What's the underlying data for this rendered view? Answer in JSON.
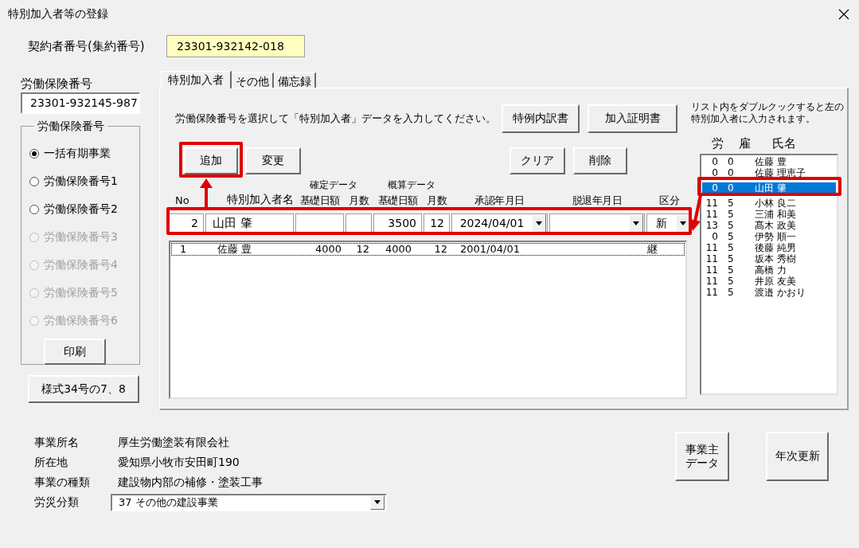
{
  "window": {
    "title": "特別加入者等の登録"
  },
  "contract": {
    "label": "契約者番号(集約番号)",
    "value": "23301-932142-018"
  },
  "insurance": {
    "label": "労働保険番号",
    "value": "23301-932145-987"
  },
  "group": {
    "title": "労働保険番号",
    "radios": [
      {
        "label": "一括有期事業",
        "selected": true,
        "disabled": false
      },
      {
        "label": "労働保険番号1",
        "selected": false,
        "disabled": false
      },
      {
        "label": "労働保険番号2",
        "selected": false,
        "disabled": false
      },
      {
        "label": "労働保険番号3",
        "selected": false,
        "disabled": true
      },
      {
        "label": "労働保険番号4",
        "selected": false,
        "disabled": true
      },
      {
        "label": "労働保険番号5",
        "selected": false,
        "disabled": true
      },
      {
        "label": "労働保険番号6",
        "selected": false,
        "disabled": true
      }
    ],
    "print_button": "印刷"
  },
  "form_button": "様式34号の7、8",
  "tabs": [
    {
      "label": "特別加入者",
      "selected": true
    },
    {
      "label": "その他",
      "selected": false
    },
    {
      "label": "備忘録",
      "selected": false
    }
  ],
  "panel": {
    "instruction": "労働保険番号を選択して「特別加入者」データを入力してください。",
    "doc_buttons": [
      "特例内訳書",
      "加入証明書"
    ],
    "edit_buttons": [
      "追加",
      "変更"
    ],
    "clear_buttons": [
      "クリア",
      "削除"
    ],
    "column_groups": [
      "確定データ",
      "概算データ"
    ],
    "columns": [
      "No",
      "特別加入者名",
      "基礎日額",
      "月数",
      "基礎日額",
      "月数",
      "承認年月日",
      "脱退年月日",
      "区分"
    ],
    "entry": [
      {
        "value": "2",
        "kind": "num"
      },
      {
        "value": "山田 肇",
        "kind": "text"
      },
      {
        "kind": "num"
      },
      {
        "kind": "num"
      },
      {
        "value": "3500",
        "kind": "num"
      },
      {
        "value": "12",
        "kind": "num"
      },
      {
        "value": "2024/04/01",
        "kind": "combo"
      },
      {
        "kind": "combo"
      },
      {
        "value": "新",
        "kind": "combo"
      }
    ],
    "rows": [
      [
        "1",
        "佐藤 豊",
        "4000",
        "12",
        "4000",
        "12",
        "2001/04/01",
        "",
        "継"
      ]
    ]
  },
  "side": {
    "hint": "リスト内をダブルクックすると左の特別加入者に入力されます。",
    "headers": [
      "労",
      "雇",
      "氏名"
    ],
    "rows": [
      {
        "cells": [
          "0",
          "0",
          "佐藤 豊"
        ],
        "selected": false
      },
      {
        "cells": [
          "0",
          "0",
          "佐藤 理恵子"
        ],
        "selected": false
      },
      {
        "cells": [
          "0",
          "0",
          "山田 肇"
        ],
        "selected": true
      },
      {
        "cells": [
          "11",
          "5",
          "小林 良二"
        ],
        "selected": false
      },
      {
        "cells": [
          "11",
          "5",
          "三浦 和美"
        ],
        "selected": false
      },
      {
        "cells": [
          "13",
          "5",
          "髙木 政美"
        ],
        "selected": false
      },
      {
        "cells": [
          "0",
          "5",
          "伊勢 順一"
        ],
        "selected": false
      },
      {
        "cells": [
          "11",
          "5",
          "後藤 純男"
        ],
        "selected": false
      },
      {
        "cells": [
          "11",
          "5",
          "坂本 秀樹"
        ],
        "selected": false
      },
      {
        "cells": [
          "11",
          "5",
          "高橋 力"
        ],
        "selected": false
      },
      {
        "cells": [
          "11",
          "5",
          "井原 友美"
        ],
        "selected": false
      },
      {
        "cells": [
          "11",
          "5",
          "渡邉 かおり"
        ],
        "selected": false
      }
    ]
  },
  "office": [
    {
      "label": "事業所名",
      "value": "厚生労働塗装有限会社"
    },
    {
      "label": "所在地",
      "value": "愛知県小牧市安田町190"
    },
    {
      "label": "事業の種類",
      "value": "建設物内部の補修・塗装工事"
    }
  ],
  "category": {
    "label": "労災分類",
    "value": "37 その他の建設事業"
  },
  "bottom_buttons": [
    "事業主データ",
    "年次更新"
  ]
}
